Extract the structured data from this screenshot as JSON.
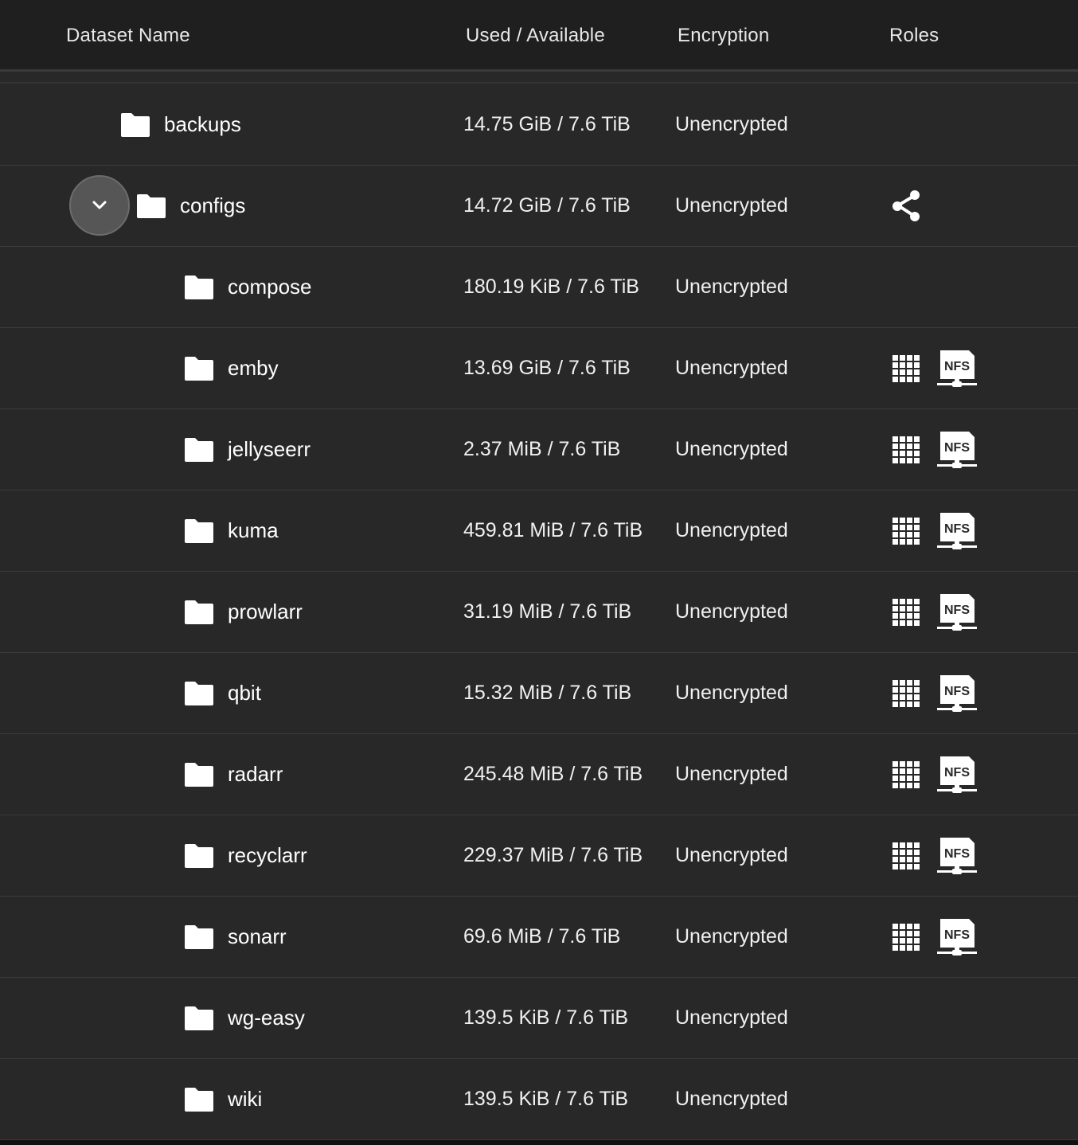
{
  "header": {
    "dataset_name": "Dataset Name",
    "used_available": "Used / Available",
    "encryption": "Encryption",
    "roles": "Roles"
  },
  "rows": [
    {
      "name": "backups",
      "used": "14.75 GiB / 7.6 TiB",
      "encryption": "Unencrypted",
      "level": 1,
      "roles": []
    },
    {
      "name": "configs",
      "used": "14.72 GiB / 7.6 TiB",
      "encryption": "Unencrypted",
      "level": 1,
      "expanded": true,
      "roles": [
        "share-icon"
      ]
    },
    {
      "name": "compose",
      "used": "180.19 KiB / 7.6 TiB",
      "encryption": "Unencrypted",
      "level": 2,
      "roles": []
    },
    {
      "name": "emby",
      "used": "13.69 GiB / 7.6 TiB",
      "encryption": "Unencrypted",
      "level": 2,
      "roles": [
        "apps-icon",
        "nfs-icon"
      ]
    },
    {
      "name": "jellyseerr",
      "used": "2.37 MiB / 7.6 TiB",
      "encryption": "Unencrypted",
      "level": 2,
      "roles": [
        "apps-icon",
        "nfs-icon"
      ]
    },
    {
      "name": "kuma",
      "used": "459.81 MiB / 7.6 TiB",
      "encryption": "Unencrypted",
      "level": 2,
      "roles": [
        "apps-icon",
        "nfs-icon"
      ]
    },
    {
      "name": "prowlarr",
      "used": "31.19 MiB / 7.6 TiB",
      "encryption": "Unencrypted",
      "level": 2,
      "roles": [
        "apps-icon",
        "nfs-icon"
      ]
    },
    {
      "name": "qbit",
      "used": "15.32 MiB / 7.6 TiB",
      "encryption": "Unencrypted",
      "level": 2,
      "roles": [
        "apps-icon",
        "nfs-icon"
      ]
    },
    {
      "name": "radarr",
      "used": "245.48 MiB / 7.6 TiB",
      "encryption": "Unencrypted",
      "level": 2,
      "roles": [
        "apps-icon",
        "nfs-icon"
      ]
    },
    {
      "name": "recyclarr",
      "used": "229.37 MiB / 7.6 TiB",
      "encryption": "Unencrypted",
      "level": 2,
      "roles": [
        "apps-icon",
        "nfs-icon"
      ]
    },
    {
      "name": "sonarr",
      "used": "69.6 MiB / 7.6 TiB",
      "encryption": "Unencrypted",
      "level": 2,
      "roles": [
        "apps-icon",
        "nfs-icon"
      ]
    },
    {
      "name": "wg-easy",
      "used": "139.5 KiB / 7.6 TiB",
      "encryption": "Unencrypted",
      "level": 2,
      "roles": []
    },
    {
      "name": "wiki",
      "used": "139.5 KiB / 7.6 TiB",
      "encryption": "Unencrypted",
      "level": 2,
      "roles": []
    }
  ],
  "nfs_badge_text": "NFS",
  "colors": {
    "background": "#282828",
    "header_background": "#1f1f1f",
    "row_divider": "#3b3b3b",
    "text": "#ffffff"
  }
}
